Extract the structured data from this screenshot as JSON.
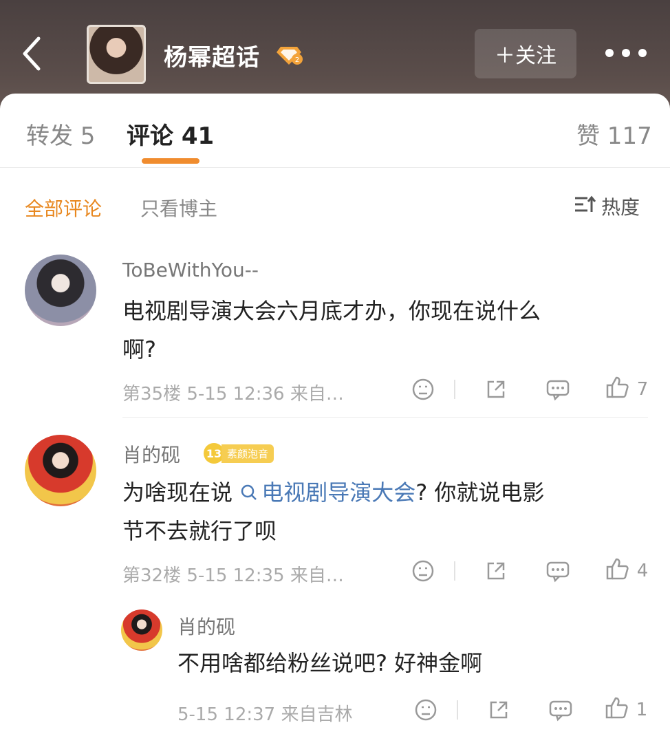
{
  "header": {
    "title": "杨幂超话",
    "follow_label": "＋关注"
  },
  "tabs": [
    {
      "label": "转发 5"
    },
    {
      "label": "评论 41"
    },
    {
      "label": "赞 117"
    }
  ],
  "filters": {
    "all": "全部评论",
    "blogger_only": "只看博主",
    "sort_label": "热度"
  },
  "comments": [
    {
      "user": "ToBeWithYou--",
      "text_line1": "电视剧导演大会六月底才办，你现在说什么",
      "text_line2": "啊?",
      "meta": "第35楼 5-15 12:36 来自…",
      "likes": "7"
    },
    {
      "user": "肖的砚",
      "level": "13",
      "level_label": "素颜泡音",
      "text_pre": "为啥现在说 ",
      "text_link": "电视剧导演大会",
      "text_post": "? 你就说电影",
      "text_line2": "节不去就行了呗",
      "meta": "第32楼 5-15 12:35 来自…",
      "likes": "4"
    },
    {
      "user": "肖的砚",
      "text_line1": "不用啥都给粉丝说吧? 好神金啊",
      "meta": "5-15 12:37 来自吉林",
      "likes": "1"
    }
  ],
  "colors": {
    "accent": "#f08c2e",
    "link": "#4a79b6"
  }
}
